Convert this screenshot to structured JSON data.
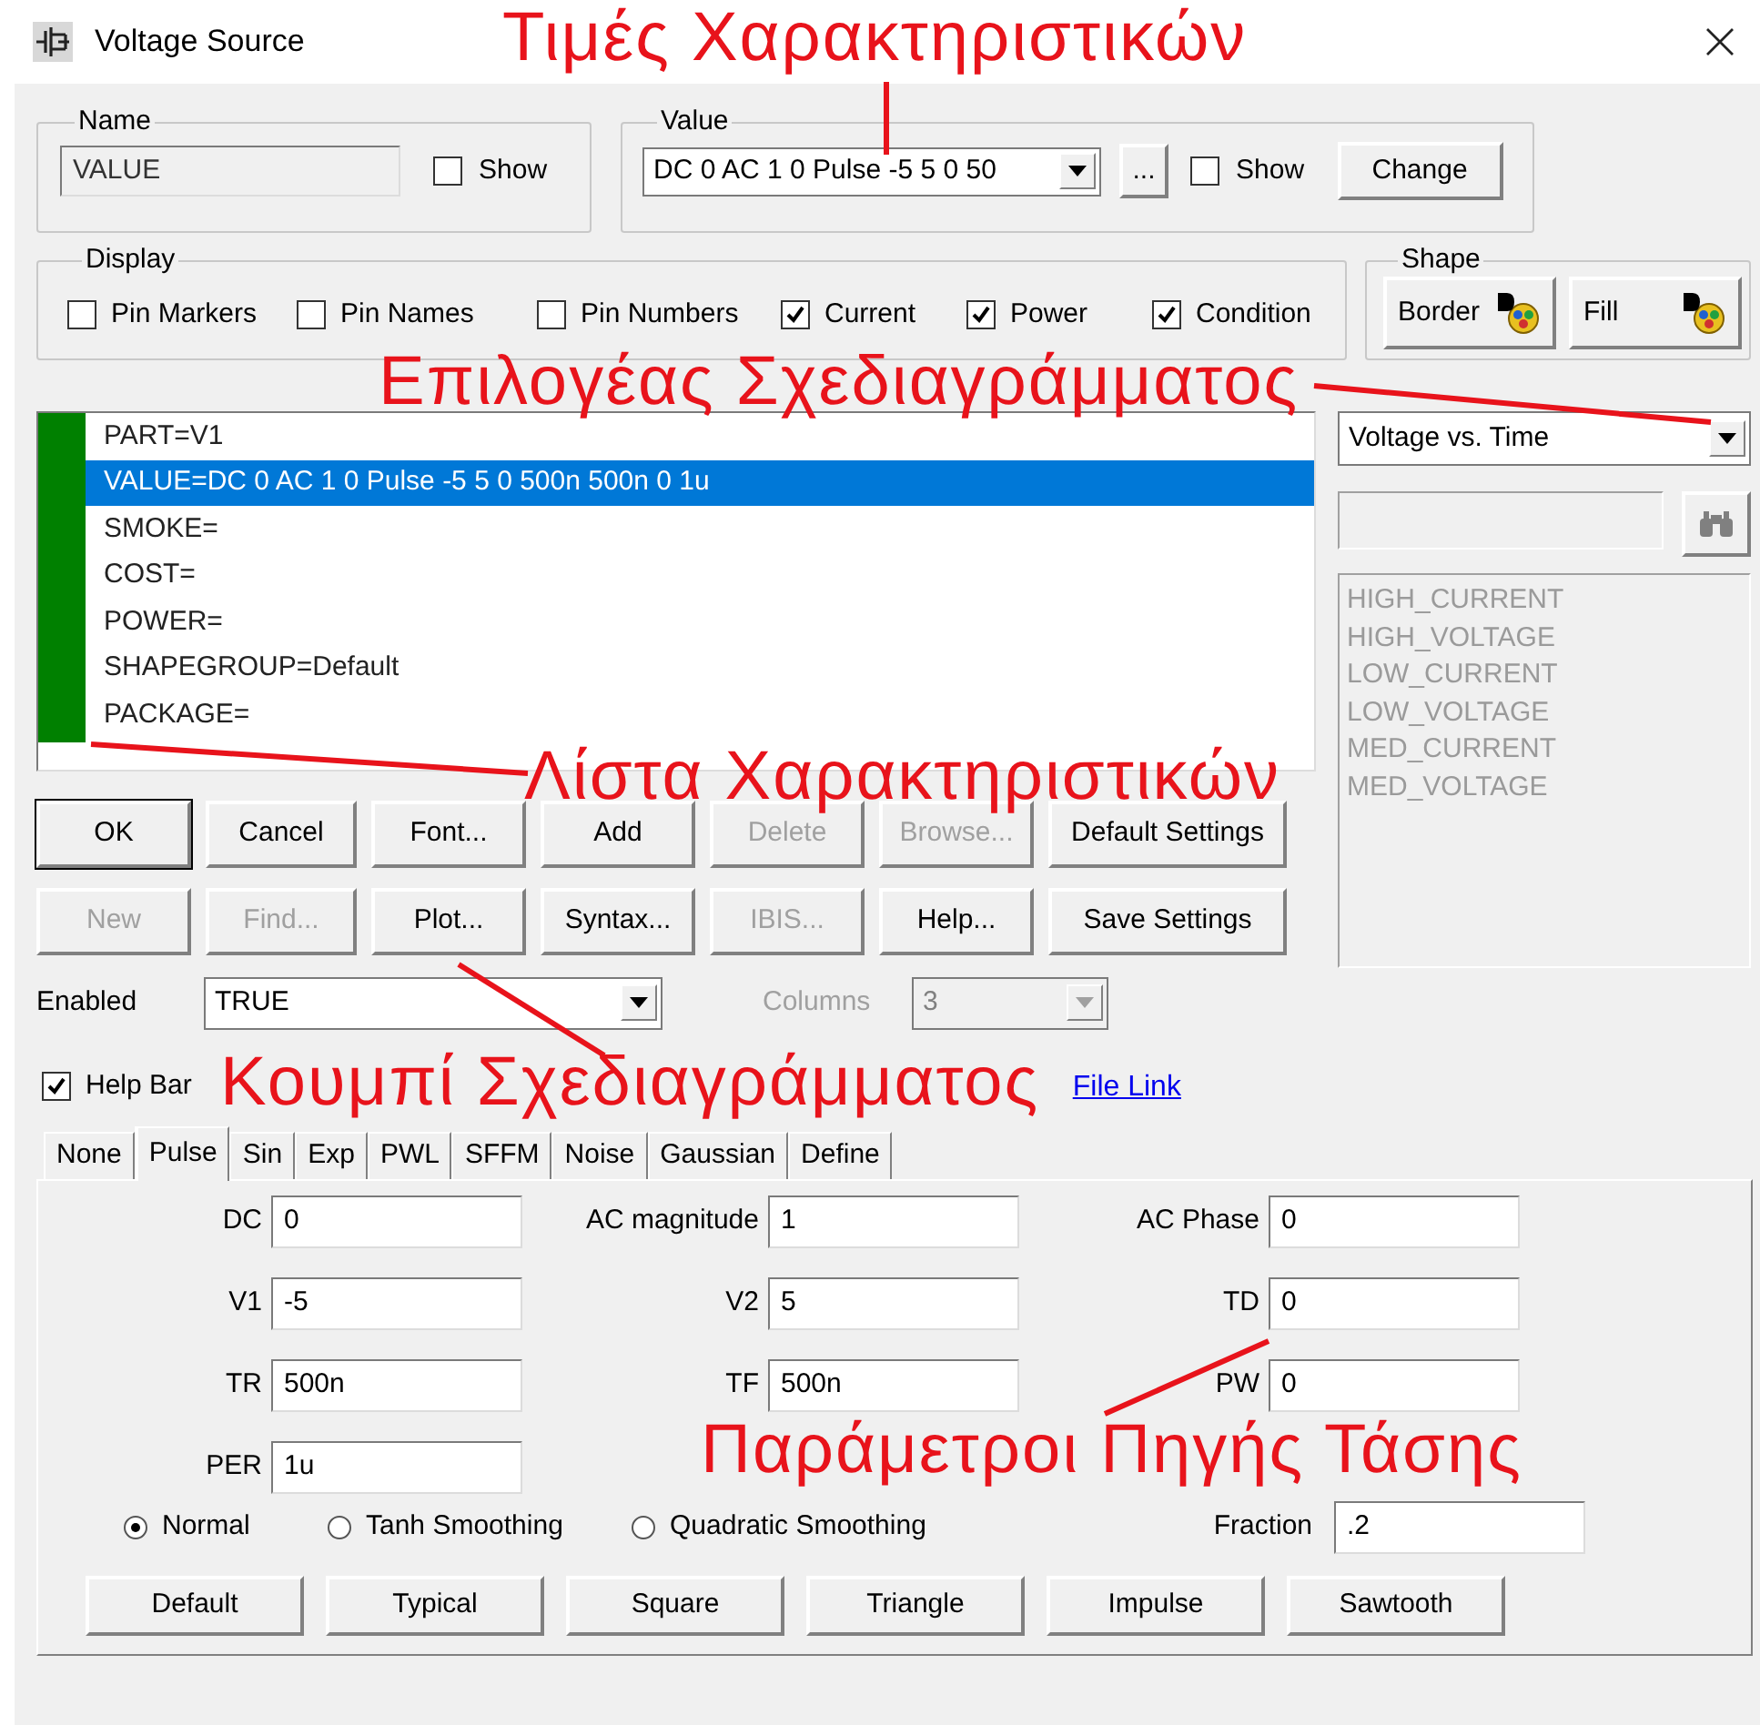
{
  "window": {
    "title": "Voltage Source"
  },
  "name_group": {
    "label": "Name",
    "value": "VALUE",
    "show": {
      "label": "Show",
      "checked": false
    }
  },
  "value_group": {
    "label": "Value",
    "value": "DC 0 AC 1 0 Pulse -5 5 0 50",
    "more_button": "...",
    "show": {
      "label": "Show",
      "checked": false
    },
    "change_button": "Change"
  },
  "display": {
    "label": "Display",
    "options": [
      {
        "label": "Pin Markers",
        "checked": false
      },
      {
        "label": "Pin Names",
        "checked": false
      },
      {
        "label": "Pin Numbers",
        "checked": false
      },
      {
        "label": "Current",
        "checked": true
      },
      {
        "label": "Power",
        "checked": true
      },
      {
        "label": "Condition",
        "checked": true
      }
    ]
  },
  "shape": {
    "label": "Shape",
    "buttons": [
      "Border",
      "Fill"
    ]
  },
  "attributes": [
    {
      "text": "PART=V1",
      "selected": false
    },
    {
      "text": "VALUE=DC 0 AC 1 0 Pulse -5 5 0 500n 500n 0 1u",
      "selected": true
    },
    {
      "text": "SMOKE=",
      "selected": false
    },
    {
      "text": "COST=",
      "selected": false
    },
    {
      "text": "POWER=",
      "selected": false
    },
    {
      "text": "SHAPEGROUP=Default",
      "selected": false
    },
    {
      "text": "PACKAGE=",
      "selected": false
    }
  ],
  "plot_selector": {
    "value": "Voltage vs. Time"
  },
  "conditions": {
    "disabled": true,
    "items": [
      "HIGH_CURRENT",
      "HIGH_VOLTAGE",
      "LOW_CURRENT",
      "LOW_VOLTAGE",
      "MED_CURRENT",
      "MED_VOLTAGE"
    ]
  },
  "buttons_row_1": [
    {
      "label": "OK",
      "disabled": false,
      "default": true
    },
    {
      "label": "Cancel",
      "disabled": false,
      "default": false
    },
    {
      "label": "Font...",
      "disabled": false,
      "default": false
    },
    {
      "label": "Add",
      "disabled": false,
      "default": false
    },
    {
      "label": "Delete",
      "disabled": true,
      "default": false
    },
    {
      "label": "Browse...",
      "disabled": true,
      "default": false
    },
    {
      "label": "Default Settings",
      "disabled": false,
      "default": false
    }
  ],
  "buttons_row_2": [
    {
      "label": "New",
      "disabled": true,
      "default": false
    },
    {
      "label": "Find...",
      "disabled": true,
      "default": false
    },
    {
      "label": "Plot...",
      "disabled": false,
      "default": false
    },
    {
      "label": "Syntax...",
      "disabled": false,
      "default": false
    },
    {
      "label": "IBIS...",
      "disabled": true,
      "default": false
    },
    {
      "label": "Help...",
      "disabled": false,
      "default": false
    },
    {
      "label": "Save Settings",
      "disabled": false,
      "default": false
    }
  ],
  "enabled": {
    "label": "Enabled",
    "value": "TRUE"
  },
  "columns": {
    "label": "Columns",
    "value": "3",
    "disabled": true
  },
  "help_bar": {
    "label": "Help Bar",
    "checked": true
  },
  "file_link": "File Link",
  "tabs": [
    {
      "label": "None",
      "selected": false
    },
    {
      "label": "Pulse",
      "selected": true
    },
    {
      "label": "Sin",
      "selected": false
    },
    {
      "label": "Exp",
      "selected": false
    },
    {
      "label": "PWL",
      "selected": false
    },
    {
      "label": "SFFM",
      "selected": false
    },
    {
      "label": "Noise",
      "selected": false
    },
    {
      "label": "Gaussian",
      "selected": false
    },
    {
      "label": "Define",
      "selected": false
    }
  ],
  "pulse_params": [
    {
      "label": "DC",
      "value": "0"
    },
    {
      "label": "AC magnitude",
      "value": "1"
    },
    {
      "label": "AC Phase",
      "value": "0"
    },
    {
      "label": "V1",
      "value": "-5"
    },
    {
      "label": "V2",
      "value": "5"
    },
    {
      "label": "TD",
      "value": "0"
    },
    {
      "label": "TR",
      "value": "500n"
    },
    {
      "label": "TF",
      "value": "500n"
    },
    {
      "label": "PW",
      "value": "0"
    },
    {
      "label": "PER",
      "value": "1u"
    }
  ],
  "smoothing": [
    {
      "label": "Normal",
      "selected": true
    },
    {
      "label": "Tanh Smoothing",
      "selected": false
    },
    {
      "label": "Quadratic Smoothing",
      "selected": false
    }
  ],
  "fraction": {
    "label": "Fraction",
    "value": ".2"
  },
  "presets": [
    "Default",
    "Typical",
    "Square",
    "Triangle",
    "Impulse",
    "Sawtooth"
  ],
  "annotations": [
    {
      "text": "Τιμές Χαρακτηριστικών"
    },
    {
      "text": "Επιλογέας Σχεδιαγράμματος"
    },
    {
      "text": "Λίστα Χαρακτηριστικών"
    },
    {
      "text": "Κουμπί Σχεδιαγράμματος"
    },
    {
      "text": "Παράμετροι Πηγής Τάσης"
    }
  ]
}
